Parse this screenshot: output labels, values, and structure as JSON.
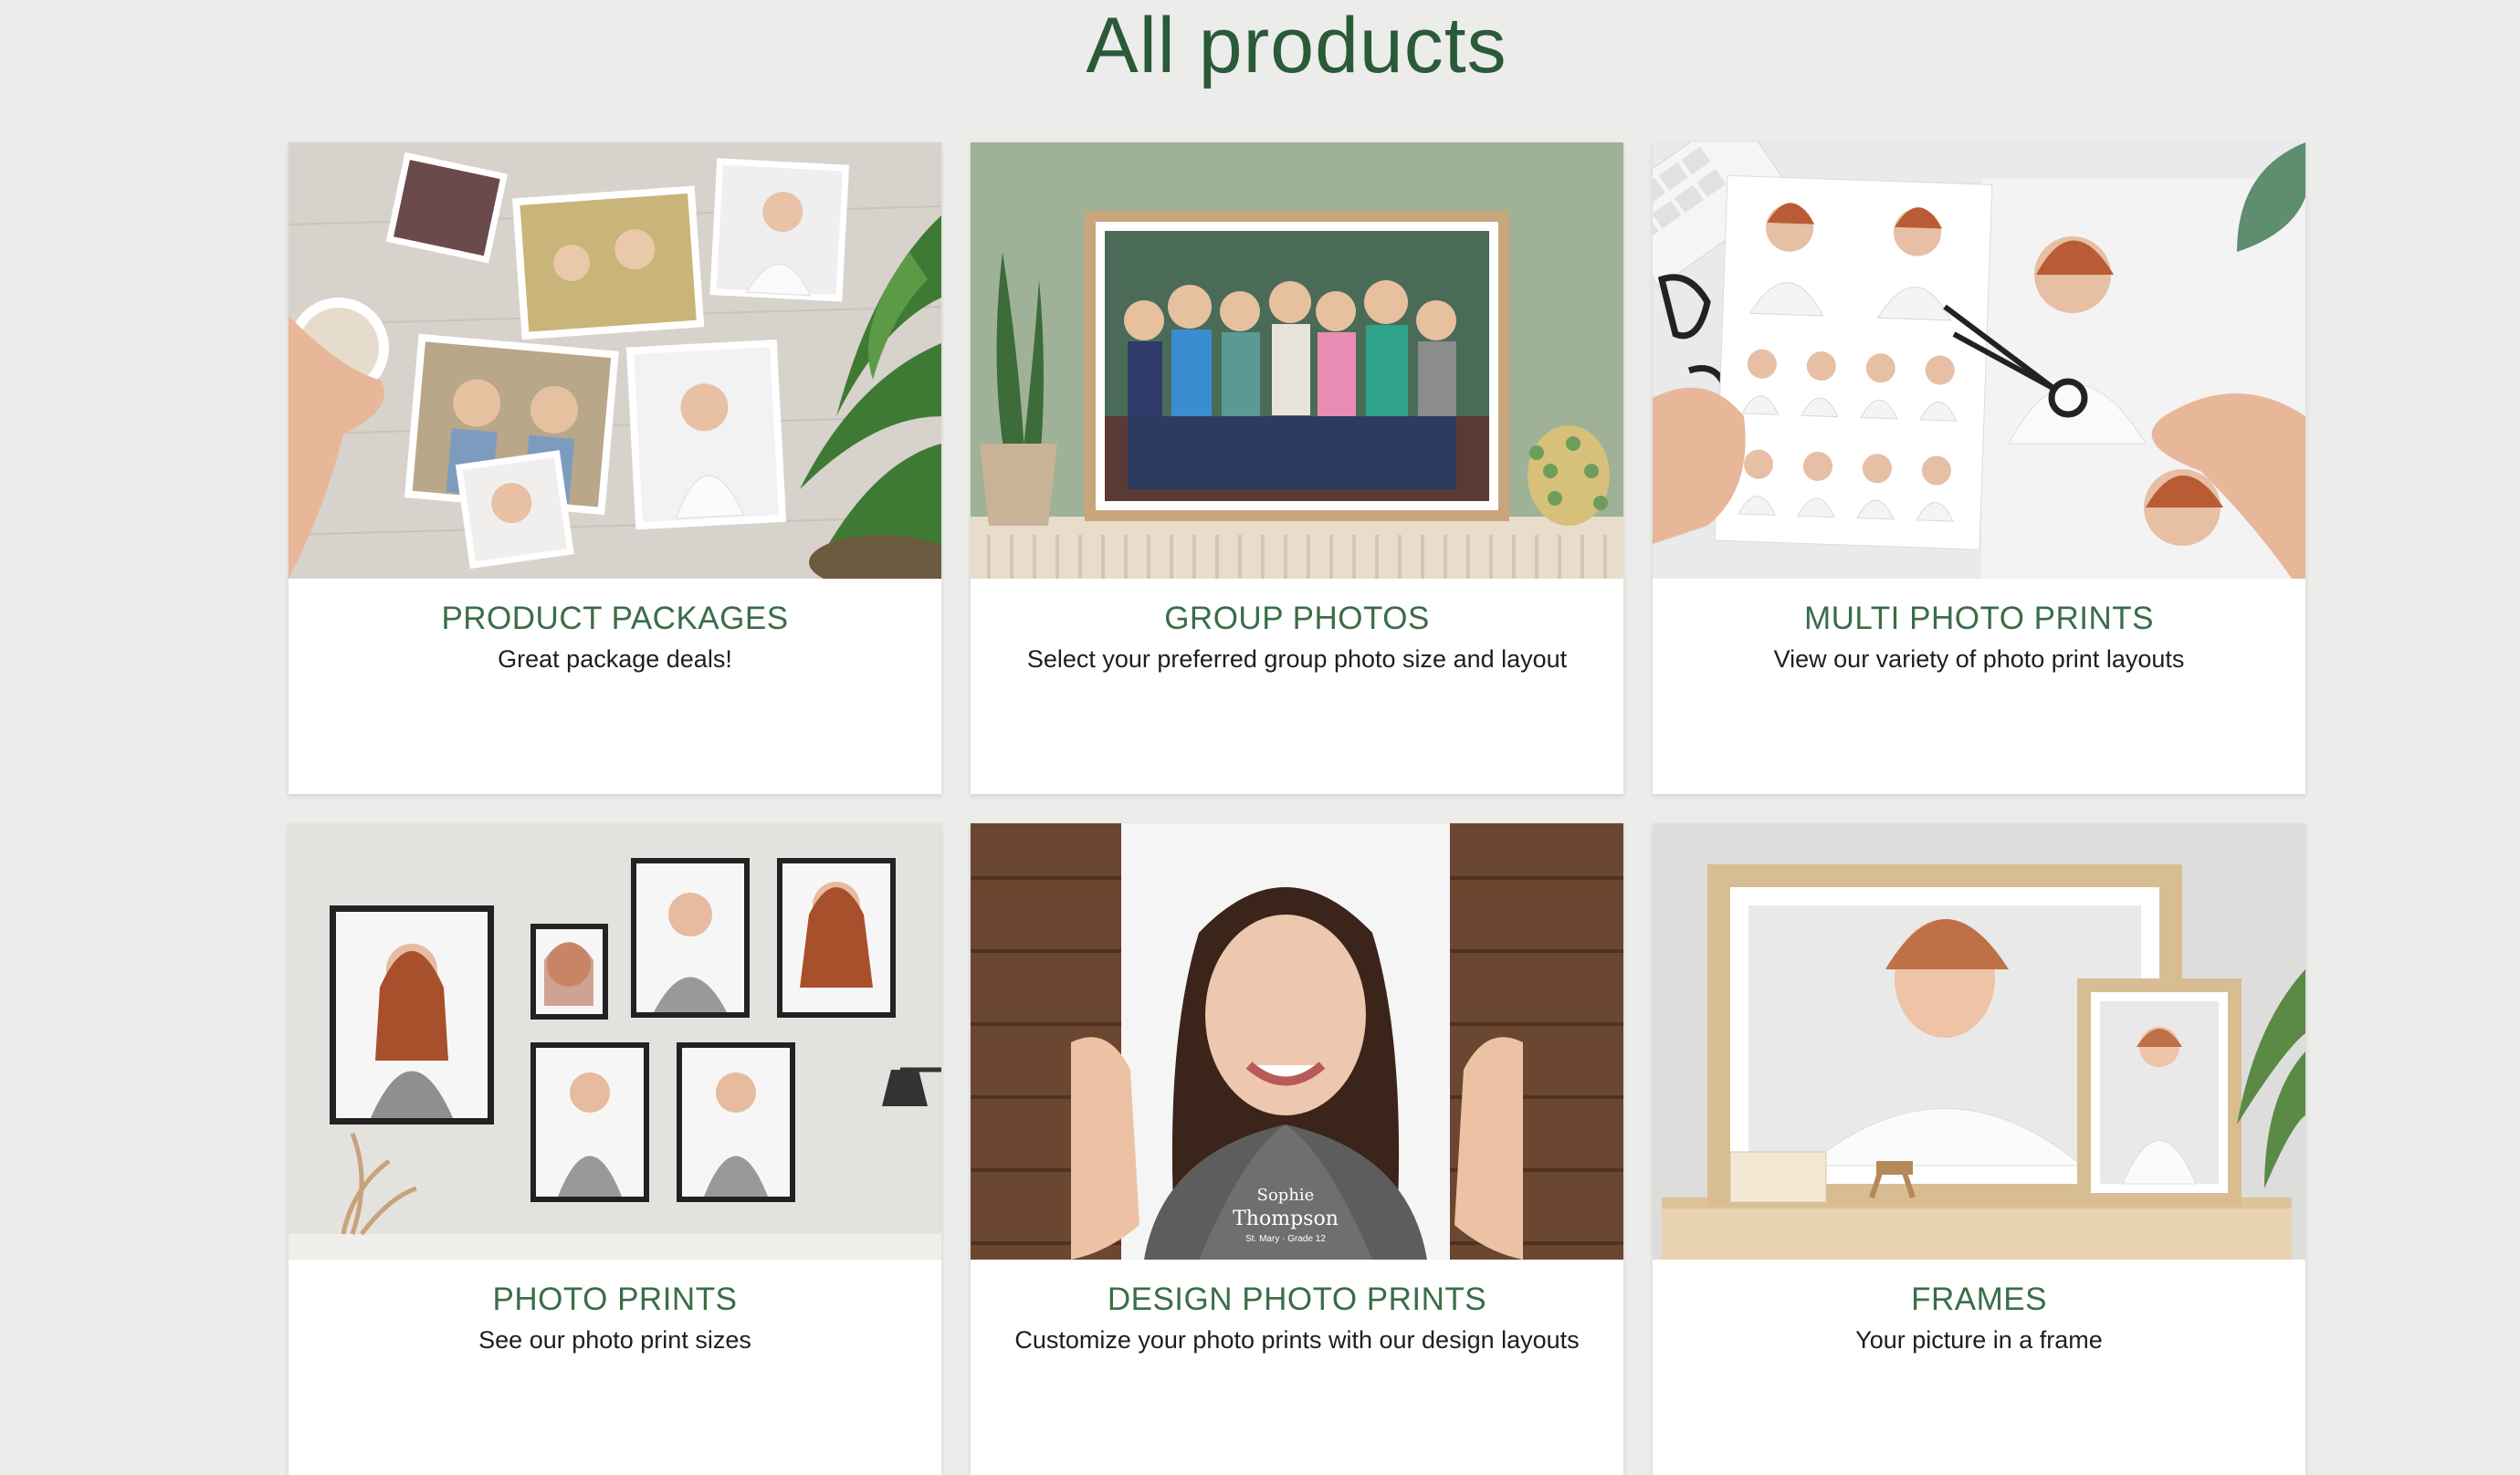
{
  "page": {
    "title": "All products"
  },
  "products": [
    {
      "title": "PRODUCT PACKAGES",
      "description": "Great package deals!",
      "image": "product-packages-photo"
    },
    {
      "title": "GROUP PHOTOS",
      "description": "Select your preferred group photo size and layout",
      "image": "group-photos-photo"
    },
    {
      "title": "MULTI PHOTO PRINTS",
      "description": "View our variety of photo print layouts",
      "image": "multi-photo-prints-photo"
    },
    {
      "title": "PHOTO PRINTS",
      "description": "See our photo print sizes",
      "image": "photo-prints-photo"
    },
    {
      "title": "DESIGN PHOTO PRINTS",
      "description": "Customize your photo prints with our design layouts",
      "image": "design-photo-prints-photo",
      "overlay": {
        "first_name": "Sophie",
        "last_name": "Thompson",
        "subtitle": "St. Mary · Grade 12"
      }
    },
    {
      "title": "FRAMES",
      "description": "Your picture in a frame",
      "image": "frames-photo"
    }
  ],
  "colors": {
    "background": "#ececeb",
    "title": "#2a5a38",
    "card_title": "#3a6d48",
    "card_text": "#1e1e1e"
  }
}
